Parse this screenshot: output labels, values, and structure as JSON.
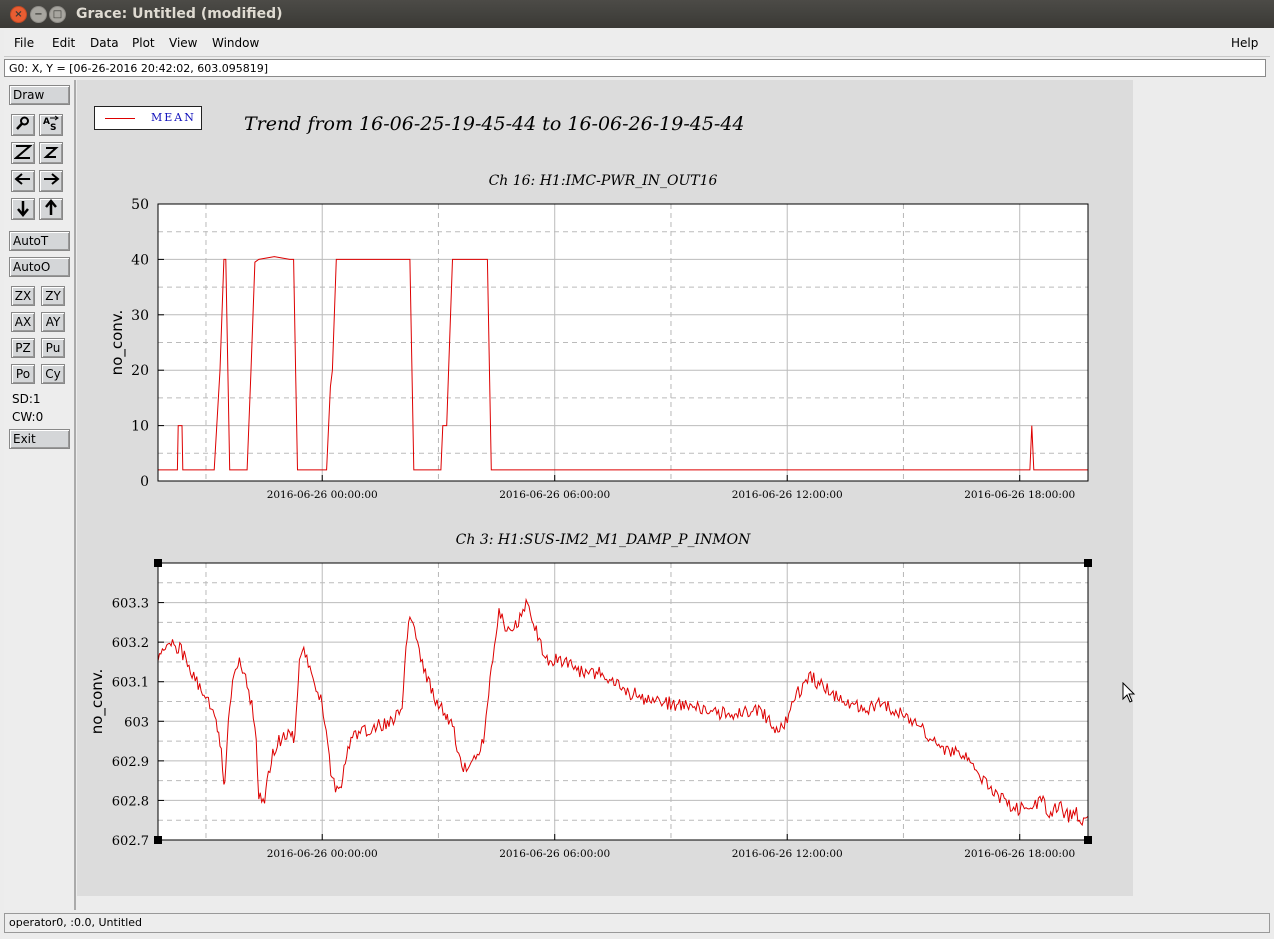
{
  "window": {
    "title": "Grace: Untitled (modified)"
  },
  "menu": {
    "items": [
      "File",
      "Edit",
      "Data",
      "Plot",
      "View",
      "Window"
    ],
    "help": "Help"
  },
  "locator": "G0: X, Y = [06-26-2016 20:42:02, 603.095819]",
  "toolbar": {
    "draw": "Draw",
    "autot": "AutoT",
    "autoo": "AutoO",
    "zx": "ZX",
    "zy": "ZY",
    "ax": "AX",
    "ay": "AY",
    "pz": "PZ",
    "pu": "Pu",
    "po": "Po",
    "cy": "Cy",
    "sd": "SD:1",
    "cw": "CW:0",
    "exit": "Exit"
  },
  "canvas": {
    "legend_label": "MEAN",
    "main_title": "Trend from 16-06-25-19-45-44 to 16-06-26-19-45-44"
  },
  "statusbar": "operator0, :0.0, Untitled",
  "colors": {
    "series": "#dd0000",
    "legend_text": "#1111bb",
    "canvas_bg": "#dcdcdc"
  },
  "chart_data": [
    {
      "type": "line",
      "title": "Ch 16: H1:IMC-PWR_IN_OUT16",
      "ylabel": "no_conv.",
      "xlabel": "",
      "x_unit": "hours since 2016-06-25 19:45:44",
      "xlim": [
        0,
        24
      ],
      "ylim": [
        0,
        50
      ],
      "yticks": [
        0,
        10,
        20,
        30,
        40,
        50
      ],
      "xtick_labels": [
        "2016-06-26 00:00:00",
        "2016-06-26 06:00:00",
        "2016-06-26 12:00:00",
        "2016-06-26 18:00:00"
      ],
      "xtick_positions": [
        4.238,
        10.238,
        16.238,
        22.238
      ],
      "grid": true,
      "series": [
        {
          "name": "MEAN",
          "x": [
            0,
            0.5,
            0.52,
            0.62,
            0.64,
            1.45,
            1.6,
            1.7,
            1.75,
            1.85,
            2.0,
            2.3,
            2.4,
            2.5,
            2.6,
            3.0,
            3.4,
            3.5,
            3.55,
            3.6,
            4.3,
            4.35,
            4.45,
            4.5,
            4.6,
            6.4,
            6.5,
            6.6,
            7.2,
            7.3,
            7.35,
            7.45,
            7.5,
            7.6,
            8.5,
            8.6,
            24.0,
            24.05,
            22.5,
            22.55,
            22.6,
            24
          ],
          "y": [
            2,
            2,
            10,
            10,
            2,
            2,
            20,
            40,
            40,
            2,
            2,
            2,
            20,
            39.5,
            40,
            40.5,
            40,
            40,
            20,
            2,
            2,
            2,
            17,
            20,
            40,
            40,
            40,
            2,
            2,
            2,
            10,
            10,
            20,
            40,
            40,
            2,
            2,
            2,
            2,
            10,
            2,
            2
          ]
        }
      ]
    },
    {
      "type": "line",
      "title": "Ch 3: H1:SUS-IM2_M1_DAMP_P_INMON",
      "ylabel": "no_conv.",
      "xlabel": "",
      "x_unit": "hours since 2016-06-25 19:45:44",
      "xlim": [
        0,
        24
      ],
      "ylim": [
        602.7,
        603.4
      ],
      "yticks": [
        602.7,
        602.8,
        602.9,
        603,
        603.1,
        603.2,
        603.3
      ],
      "xtick_labels": [
        "2016-06-26 00:00:00",
        "2016-06-26 06:00:00",
        "2016-06-26 12:00:00",
        "2016-06-26 18:00:00"
      ],
      "xtick_positions": [
        4.238,
        10.238,
        16.238,
        22.238
      ],
      "grid": true,
      "series": [
        {
          "name": "MEAN",
          "x": [
            0,
            0.3,
            0.6,
            1.0,
            1.3,
            1.5,
            1.6,
            1.7,
            1.75,
            1.85,
            2.0,
            2.1,
            2.3,
            2.5,
            2.6,
            2.75,
            2.85,
            3.0,
            3.2,
            3.4,
            3.5,
            3.6,
            3.65,
            3.8,
            4.0,
            4.2,
            4.3,
            4.5,
            4.7,
            4.8,
            4.9,
            5.1,
            5.5,
            6.0,
            6.3,
            6.4,
            6.5,
            6.7,
            6.9,
            7.2,
            7.4,
            7.5,
            7.6,
            7.8,
            8.0,
            8.4,
            8.5,
            8.6,
            8.8,
            9.0,
            9.3,
            9.5,
            9.8,
            10.0,
            10.5,
            11.0,
            11.5,
            12.0,
            12.5,
            13.0,
            13.5,
            14.0,
            14.5,
            15.0,
            15.5,
            16.0,
            16.2,
            16.4,
            16.8,
            17.0,
            17.5,
            18.0,
            18.3,
            18.6,
            19.0,
            19.5,
            20.0,
            20.3,
            20.7,
            21.0,
            21.3,
            21.5,
            21.8,
            22.0,
            22.4,
            22.8,
            23.0,
            23.3,
            23.5,
            23.7,
            23.85,
            24.0
          ],
          "y": [
            603.15,
            603.2,
            603.18,
            603.1,
            603.05,
            603.0,
            602.95,
            602.85,
            602.87,
            603.05,
            603.13,
            603.15,
            603.1,
            603.0,
            602.82,
            602.8,
            602.87,
            602.93,
            602.96,
            602.98,
            602.95,
            603.05,
            603.15,
            603.18,
            603.1,
            603.05,
            603.0,
            602.85,
            602.82,
            602.88,
            602.93,
            602.97,
            602.98,
            603.0,
            603.02,
            603.2,
            603.27,
            603.2,
            603.12,
            603.05,
            603.02,
            603.0,
            603.0,
            602.9,
            602.87,
            602.95,
            603.05,
            603.12,
            603.28,
            603.22,
            603.25,
            603.3,
            603.22,
            603.16,
            603.15,
            603.12,
            603.12,
            603.08,
            603.06,
            603.05,
            603.04,
            603.03,
            603.02,
            603.02,
            603.03,
            602.98,
            603.0,
            603.05,
            603.12,
            603.1,
            603.06,
            603.04,
            603.03,
            603.05,
            603.03,
            603.0,
            602.95,
            602.93,
            602.92,
            602.9,
            602.85,
            602.82,
            602.8,
            602.78,
            602.78,
            602.8,
            602.77,
            602.78,
            602.76,
            602.77,
            602.75,
            602.76
          ]
        }
      ]
    }
  ]
}
